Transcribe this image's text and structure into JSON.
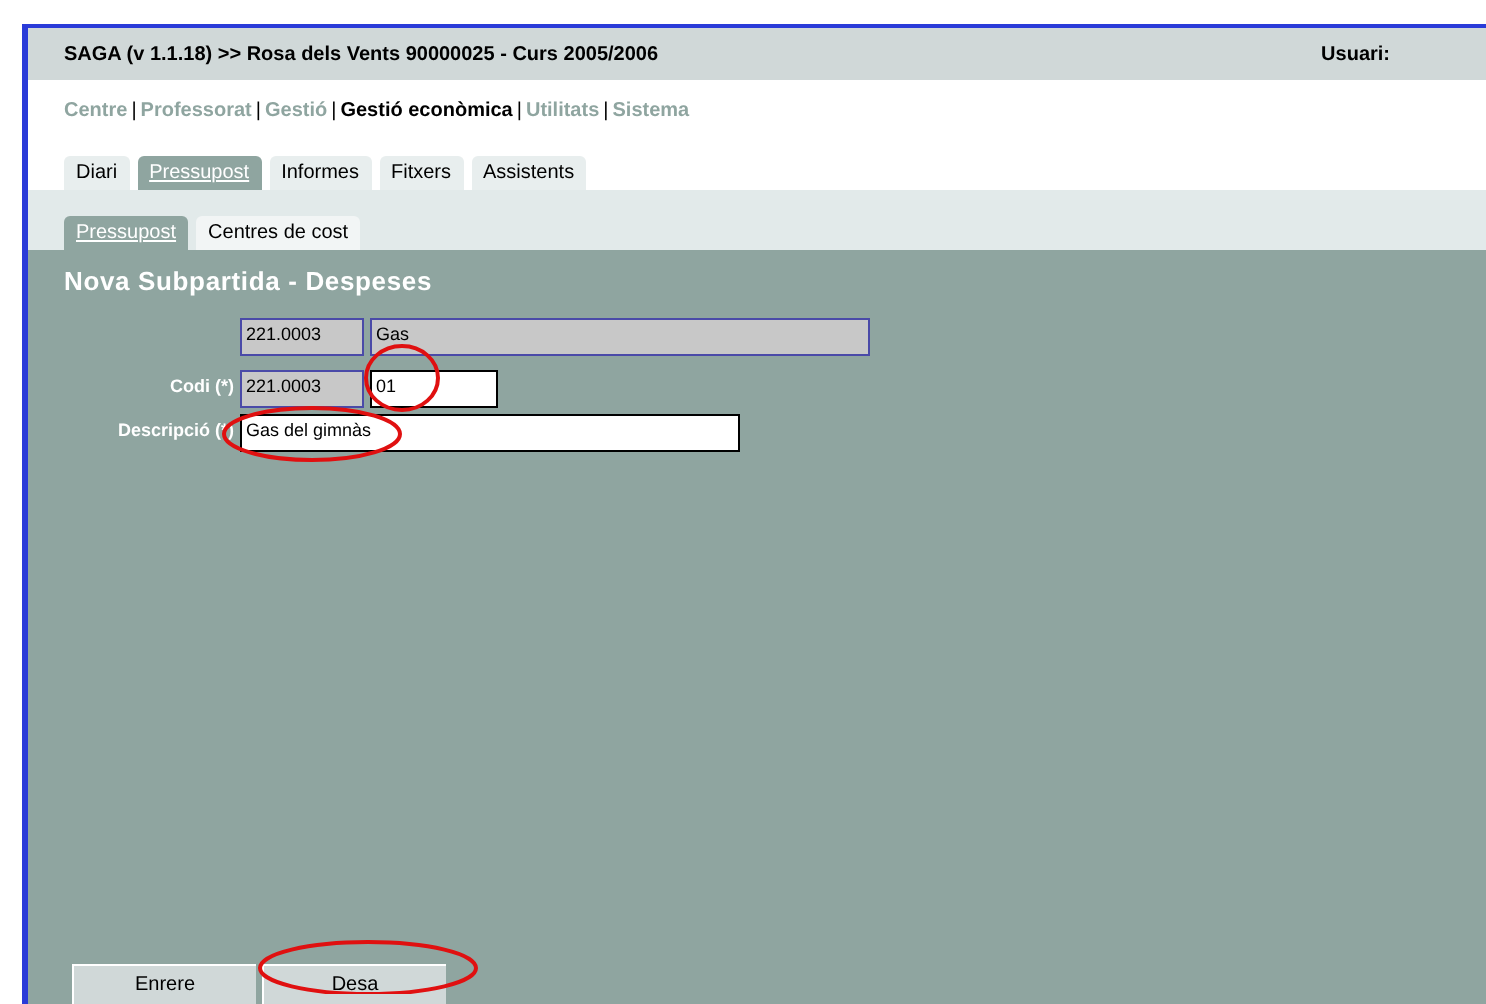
{
  "header": {
    "title": "SAGA (v 1.1.18) >> Rosa dels Vents 90000025 - Curs 2005/2006",
    "user_label": "Usuari:"
  },
  "menu": [
    {
      "label": "Centre",
      "selected": false
    },
    {
      "separator": "|",
      "label": "Professorat",
      "selected": false
    },
    {
      "separator": "|",
      "label": "Gestió",
      "selected": false
    },
    {
      "separator": "|",
      "label": "Gestió econòmica",
      "selected": true
    },
    {
      "separator": "|",
      "label": "Utilitats",
      "selected": false
    },
    {
      "separator": "|",
      "label": "Sistema",
      "selected": false
    }
  ],
  "tabs": [
    {
      "label": "Diari",
      "selected": false
    },
    {
      "label": "Pressupost",
      "selected": true
    },
    {
      "label": "Informes",
      "selected": false
    },
    {
      "label": "Fitxers",
      "selected": false
    },
    {
      "label": "Assistents",
      "selected": false
    }
  ],
  "subtabs": [
    {
      "label": "Pressupost",
      "selected": true
    },
    {
      "label": "Centres de cost",
      "selected": false
    }
  ],
  "form": {
    "title": "Nova Subpartida - Despeses",
    "parent_code": "221.0003",
    "parent_name": "Gas",
    "code_label": "Codi (*)",
    "code_prefix": "221.0003",
    "code_value": "01",
    "description_label": "Descripció (*)",
    "description_value": "Gas del gimnàs"
  },
  "buttons": [
    {
      "label": "Enrere"
    },
    {
      "label": "Desa"
    }
  ]
}
